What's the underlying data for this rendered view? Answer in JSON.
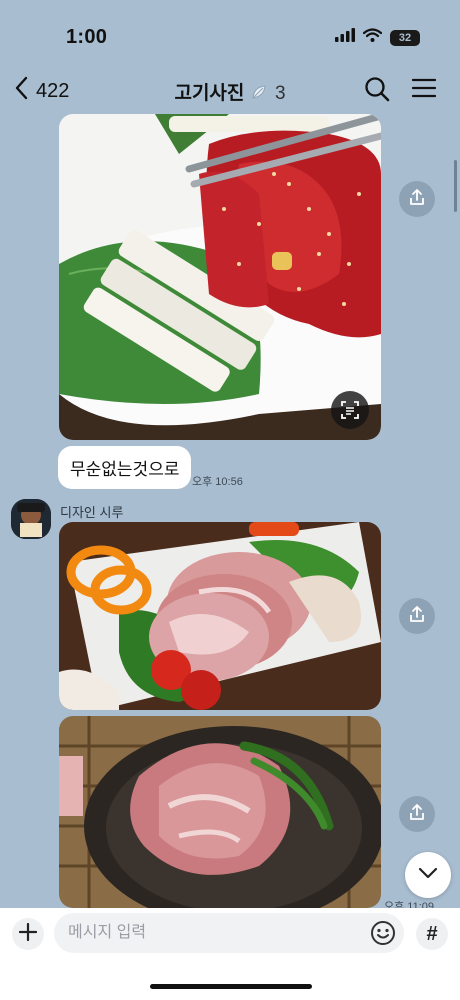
{
  "status": {
    "time": "1:00",
    "battery": "32"
  },
  "nav": {
    "back_count": "422",
    "title": "고기사진",
    "members": "3"
  },
  "messages": {
    "text_bubble": "무순없는것으로",
    "text_time": "오후 10:56",
    "sender_name": "디자인 시루",
    "last_time": "오후 11:09"
  },
  "input": {
    "placeholder": "메시지 입력"
  },
  "icons": [
    "chevron-left-icon",
    "search-icon",
    "menu-icon",
    "share-icon",
    "scan-text-icon",
    "chevron-down-icon",
    "plus-icon",
    "emoji-icon",
    "hash-icon",
    "signal-icon",
    "wifi-icon",
    "battery-icon"
  ],
  "colors": {
    "chat_background": "#a8bdd0",
    "bubble": "#ffffff",
    "input_bar": "#ffffff"
  }
}
